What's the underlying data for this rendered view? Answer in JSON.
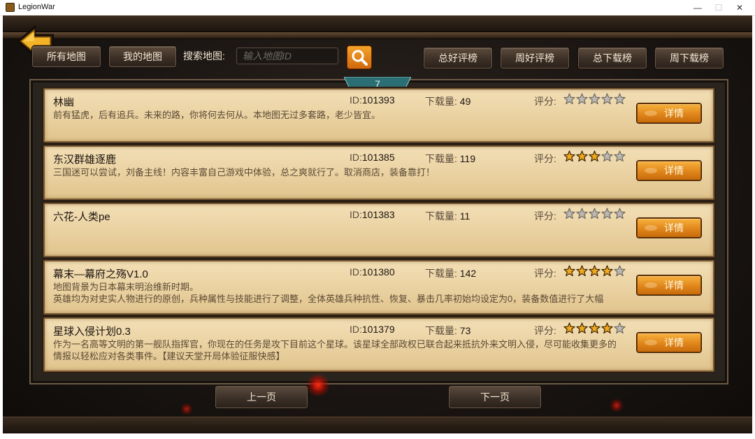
{
  "window": {
    "title": "LegionWar",
    "minimize": "—",
    "maximize": "☐",
    "close": "✕"
  },
  "toolbar": {
    "all_maps": "所有地图",
    "my_maps": "我的地图",
    "search_label": "搜索地图:",
    "search_placeholder": "输入地图ID",
    "search_value": ""
  },
  "rank_tabs": [
    "总好评榜",
    "周好评榜",
    "总下载榜",
    "周下载榜"
  ],
  "page_number": "7",
  "labels": {
    "id": "ID:",
    "downloads": "下载量:",
    "rating": "评分:",
    "detail": "详情"
  },
  "maps": [
    {
      "name": "林幽",
      "id": "101393",
      "downloads": "49",
      "rating": 0,
      "desc": [
        "前有猛虎，后有追兵。未来的路，你将何去何从。本地图无过多套路，老少皆宜。"
      ]
    },
    {
      "name": "东汉群雄逐鹿",
      "id": "101385",
      "downloads": "119",
      "rating": 3,
      "desc": [
        "三国迷可以尝试，刘备主线！内容丰富自己游戏中体验，总之爽就行了。取消商店，装备靠打！"
      ]
    },
    {
      "name": "六花-人类pe",
      "id": "101383",
      "downloads": "11",
      "rating": 0,
      "desc": []
    },
    {
      "name": "幕末—幕府之殇V1.0",
      "id": "101380",
      "downloads": "142",
      "rating": 4,
      "desc": [
        "地图背景为日本幕末明治维新时期。",
        "英雄均为对史实人物进行的原创，兵种属性与技能进行了调整，全体英雄兵种抗性、恢复、暴击几率初始均设定为0，装备数值进行了大幅"
      ]
    },
    {
      "name": "星球入侵计划0.3",
      "id": "101379",
      "downloads": "73",
      "rating": 4,
      "desc": [
        "作为一名高等文明的第一舰队指挥官，你现在的任务是攻下目前这个星球。该星球全部政权已联合起来抵抗外来文明入侵，尽可能收集更多的",
        "情报以轻松应对各类事件。【建议天堂开局体验征服快感】"
      ]
    }
  ],
  "pager": {
    "prev": "上一页",
    "next": "下一页"
  },
  "colors": {
    "accent_orange": "#e0861b",
    "card_bg": "#ead2a2",
    "panel_bg": "#2a241f",
    "star_gold": "#f0a81c",
    "star_empty": "#bdb8b0",
    "page_tab": "#2b6f74"
  }
}
